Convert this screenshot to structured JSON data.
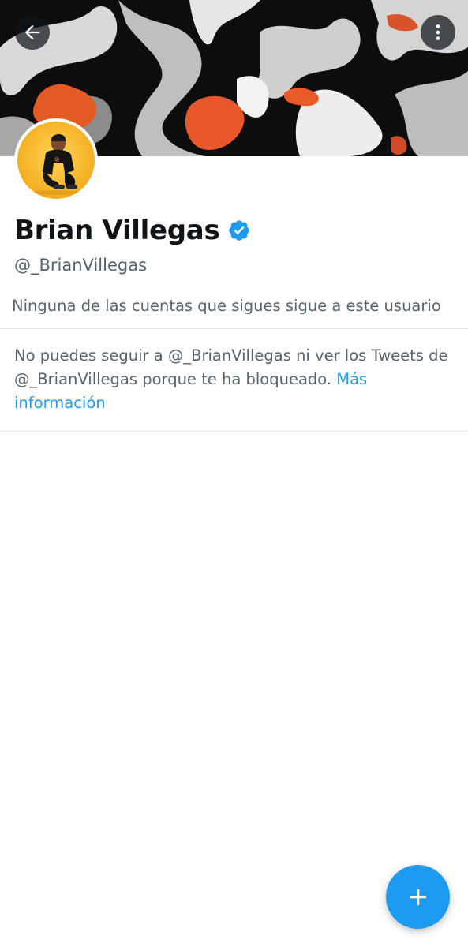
{
  "profile": {
    "display_name": "Brian Villegas",
    "handle": "@_BrianVillegas",
    "verified": true
  },
  "followers_note": "Ninguna de las cuentas que sigues sigue a este usuario",
  "blocked": {
    "message": "No puedes seguir a @_BrianVillegas ni ver los Tweets de @_BrianVillegas porque te ha bloqueado. ",
    "link_label": "Más información"
  },
  "icons": {
    "back": "arrow-left-icon",
    "more": "more-vertical-icon",
    "verified": "verified-badge-icon",
    "compose": "plus-icon"
  },
  "colors": {
    "accent": "#1d9bf0",
    "text_primary": "#0f1419",
    "text_secondary": "#536471",
    "divider": "#dfe3e7"
  }
}
